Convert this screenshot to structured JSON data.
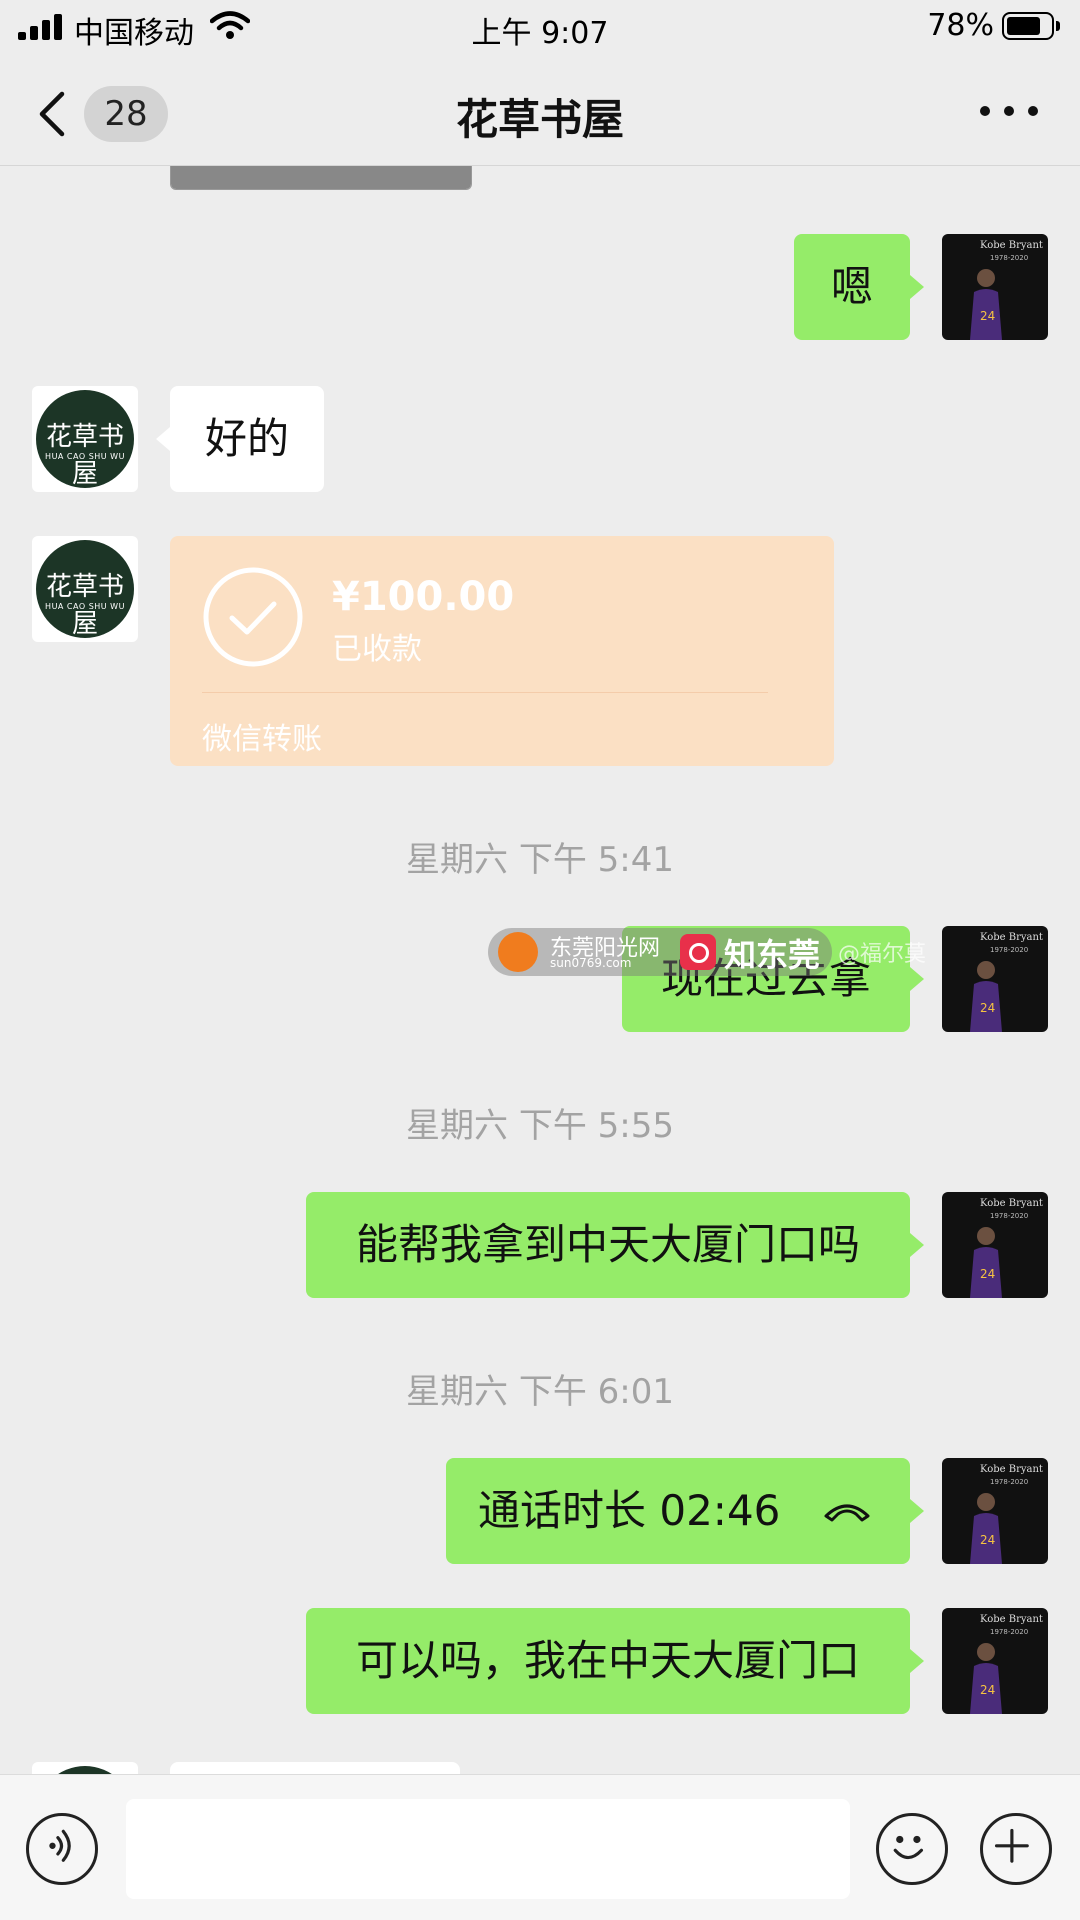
{
  "status_bar": {
    "carrier": "中国移动",
    "time": "上午 9:07",
    "battery_percent": "78%",
    "battery_level": 0.78
  },
  "nav": {
    "unread_count": "28",
    "title": "花草书屋",
    "icons": [
      "back-chevron-icon",
      "more-icon"
    ]
  },
  "shop_avatar": {
    "logo_text": "花草书屋",
    "logo_subtext": "HUA CAO SHU WU"
  },
  "my_avatar": {
    "name": "Kobe Bryant",
    "years": "1978-2020",
    "jersey": "24"
  },
  "messages": [
    {
      "from": "me",
      "text": "嗯"
    },
    {
      "from": "shop",
      "text": "好的"
    },
    {
      "from": "shop",
      "type": "transfer",
      "amount": "¥100.00",
      "state": "已收款",
      "label": "微信转账"
    },
    {
      "type": "timestamp",
      "text": "星期六 下午 5:41"
    },
    {
      "from": "me",
      "text": "现在过去拿"
    },
    {
      "type": "timestamp",
      "text": "星期六 下午 5:55"
    },
    {
      "from": "me",
      "text": "能帮我拿到中天大厦门口吗"
    },
    {
      "type": "timestamp",
      "text": "星期六 下午 6:01"
    },
    {
      "from": "me",
      "type": "call",
      "text": "通话时长 02:46"
    },
    {
      "from": "me",
      "text": "可以吗，我在中天大厦门口"
    }
  ],
  "watermark": {
    "site": "东莞阳光网",
    "url": "sun0769.com",
    "app": "知东莞",
    "user": "@福尔莫"
  },
  "input_bar": {
    "placeholder": "",
    "icons": [
      "voice-icon",
      "emoji-icon",
      "plus-icon"
    ]
  },
  "colors": {
    "background": "#ededed",
    "bubble_out": "#95ec69",
    "bubble_in": "#ffffff",
    "transfer_card": "#fbe0c4",
    "timestamp": "#a3a3a3"
  }
}
